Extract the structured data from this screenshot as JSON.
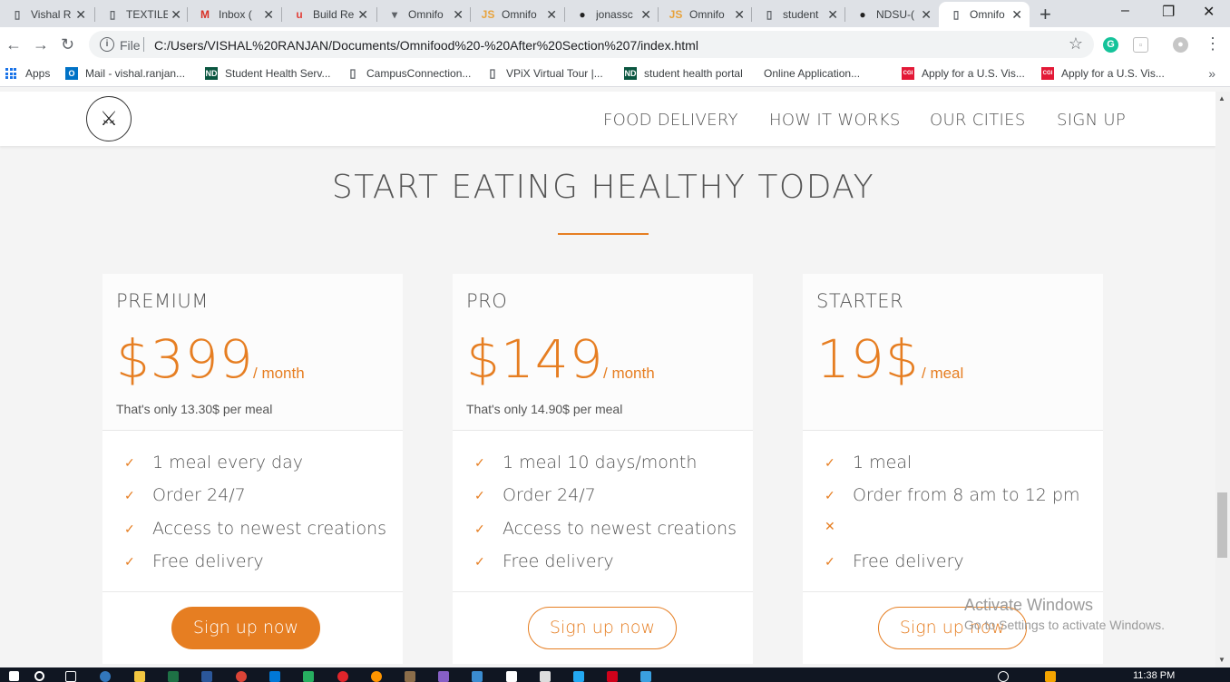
{
  "browser": {
    "tabs": [
      {
        "title": "Vishal R",
        "icon": "page-icon",
        "glyph": "▯",
        "color": "#5f6368"
      },
      {
        "title": "TEXTILE",
        "icon": "page-icon",
        "glyph": "▯",
        "color": "#5f6368"
      },
      {
        "title": "Inbox (",
        "icon": "gmail-icon",
        "glyph": "M",
        "color": "#d93025"
      },
      {
        "title": "Build Re",
        "icon": "resume-icon",
        "glyph": "u",
        "color": "#e2403a"
      },
      {
        "title": "Omnifo",
        "icon": "omnifood-icon",
        "glyph": "▾",
        "color": "#5f6368"
      },
      {
        "title": "Omnifo",
        "icon": "js-icon",
        "glyph": "JS",
        "color": "#e8a33c"
      },
      {
        "title": "jonassc",
        "icon": "github-icon",
        "glyph": "●",
        "color": "#222"
      },
      {
        "title": "Omnifo",
        "icon": "js-icon",
        "glyph": "JS",
        "color": "#e8a33c"
      },
      {
        "title": "student",
        "icon": "page-icon",
        "glyph": "▯",
        "color": "#5f6368"
      },
      {
        "title": "NDSU-(",
        "icon": "github-icon",
        "glyph": "●",
        "color": "#222"
      },
      {
        "title": "Omnifo",
        "icon": "page-icon",
        "glyph": "▯",
        "color": "#5f6368",
        "active": true
      }
    ],
    "new_tab": "+",
    "window_controls": {
      "minimize": "–",
      "maximize": "❐",
      "close": "✕"
    },
    "nav": {
      "back": "←",
      "forward": "→",
      "reload": "↻"
    },
    "address": {
      "scheme_label": "File",
      "url": "C:/Users/VISHAL%20RANJAN/Documents/Omnifood%20-%20After%20Section%207/index.html"
    },
    "bookmarks": [
      {
        "label": "Apps",
        "icon": "apps-grid-icon"
      },
      {
        "label": "Mail - vishal.ranjan...",
        "icon": "outlook-icon",
        "glyph": "O",
        "color": "#0072c6"
      },
      {
        "label": "Student Health Serv...",
        "icon": "ndsu-icon",
        "glyph": "ND",
        "color": "#0a5640"
      },
      {
        "label": "CampusConnection...",
        "icon": "page-icon",
        "glyph": "▯",
        "color": "#5f6368"
      },
      {
        "label": "VPiX Virtual Tour |...",
        "icon": "page-icon",
        "glyph": "▯",
        "color": "#5f6368"
      },
      {
        "label": "student health portal",
        "icon": "ndsu-icon",
        "glyph": "ND",
        "color": "#0a5640"
      },
      {
        "label": "Online Application...",
        "icon": "blank-icon",
        "glyph": "",
        "color": "#fff"
      },
      {
        "label": "Apply for a U.S. Vis...",
        "icon": "cgi-icon",
        "glyph": "CGI",
        "color": "#e31937"
      },
      {
        "label": "Apply for a U.S. Vis...",
        "icon": "cgi-icon",
        "glyph": "CGI",
        "color": "#e31937"
      }
    ],
    "bookmarks_more": "»"
  },
  "site": {
    "logo_glyph": "⚔",
    "nav": [
      "FOOD DELIVERY",
      "HOW IT WORKS",
      "OUR CITIES",
      "SIGN UP"
    ],
    "section_title": "START EATING HEALTHY TODAY",
    "accent_color": "#e67e22",
    "plans": [
      {
        "name": "PREMIUM",
        "price": "$399",
        "unit": "/ month",
        "note": "That's only 13.30$ per meal",
        "features": [
          {
            "icon": "check-icon",
            "glyph": "✓",
            "text": "1 meal every day"
          },
          {
            "icon": "check-icon",
            "glyph": "✓",
            "text": "Order 24/7"
          },
          {
            "icon": "check-icon",
            "glyph": "✓",
            "text": "Access to newest creations"
          },
          {
            "icon": "check-icon",
            "glyph": "✓",
            "text": "Free delivery"
          }
        ],
        "button": "Sign up now",
        "button_style": "solid"
      },
      {
        "name": "PRO",
        "price": "$149",
        "unit": "/ month",
        "note": "That's only 14.90$ per meal",
        "features": [
          {
            "icon": "check-icon",
            "glyph": "✓",
            "text": "1 meal 10 days/month"
          },
          {
            "icon": "check-icon",
            "glyph": "✓",
            "text": "Order 24/7"
          },
          {
            "icon": "check-icon",
            "glyph": "✓",
            "text": "Access to newest creations"
          },
          {
            "icon": "check-icon",
            "glyph": "✓",
            "text": "Free delivery"
          }
        ],
        "button": "Sign up now",
        "button_style": "ghost"
      },
      {
        "name": "STARTER",
        "price": "19$",
        "unit": "/ meal",
        "note": "",
        "features": [
          {
            "icon": "check-icon",
            "glyph": "✓",
            "text": "1 meal"
          },
          {
            "icon": "check-icon",
            "glyph": "✓",
            "text": "Order from 8 am to 12 pm"
          },
          {
            "icon": "cross-icon",
            "glyph": "✕",
            "text": ""
          },
          {
            "icon": "check-icon",
            "glyph": "✓",
            "text": "Free delivery"
          }
        ],
        "button": "Sign up now",
        "button_style": "ghost"
      }
    ]
  },
  "watermark": {
    "line1": "Activate Windows",
    "line2": "Go to Settings to activate Windows."
  },
  "taskbar": {
    "clock": "11:38 PM"
  }
}
